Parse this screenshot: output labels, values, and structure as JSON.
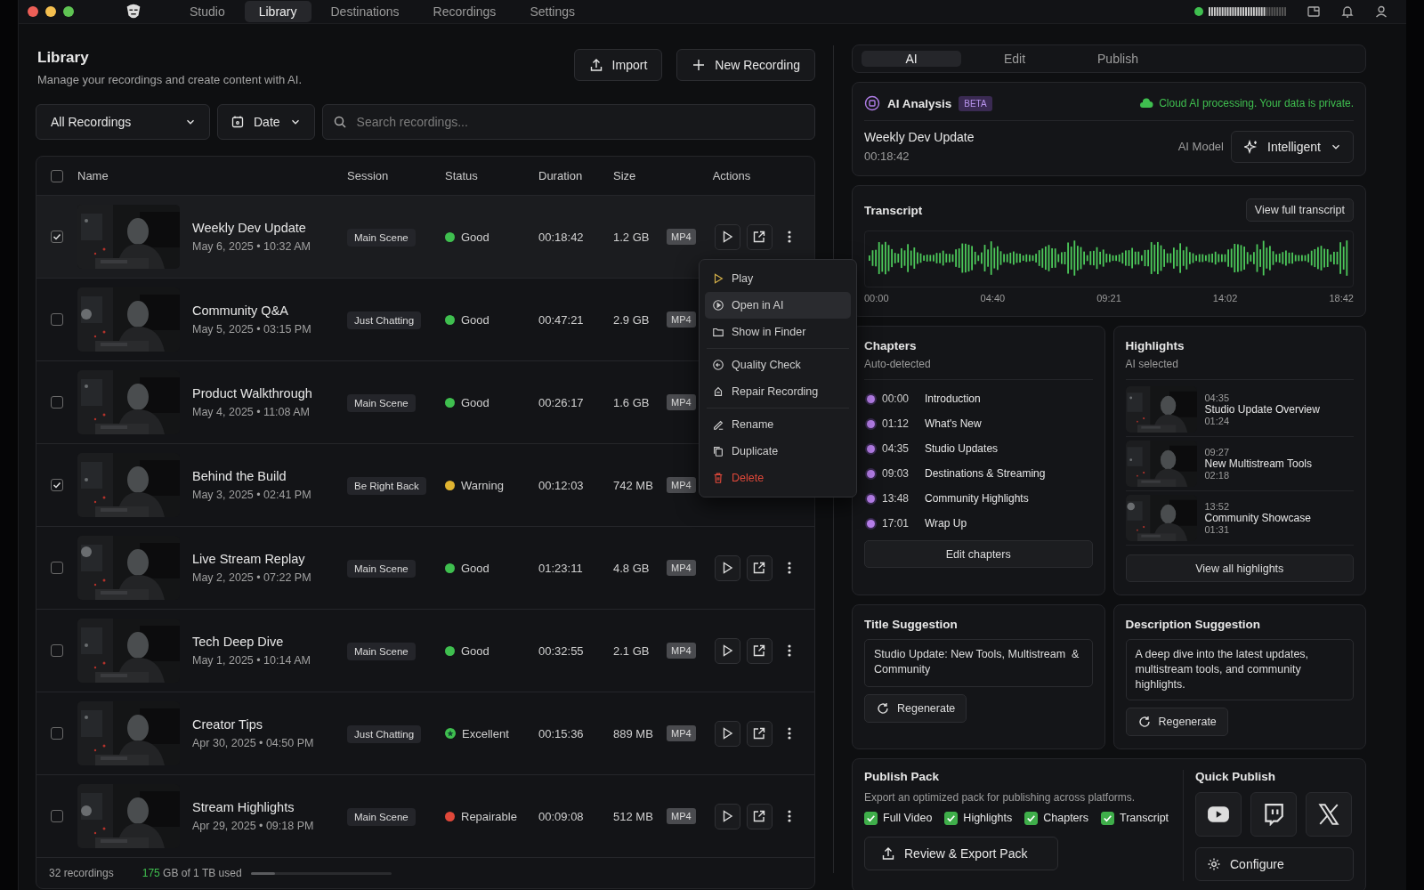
{
  "window": {
    "nav": [
      {
        "label": "Studio",
        "selected": false
      },
      {
        "label": "Library",
        "selected": true
      },
      {
        "label": "Destinations",
        "selected": false
      },
      {
        "label": "Recordings",
        "selected": false
      },
      {
        "label": "Settings",
        "selected": false
      }
    ]
  },
  "library": {
    "title": "Library",
    "subtitle": "Manage your recordings and create content with AI.",
    "import_button": "Import",
    "new_button": "New Recording",
    "filter": "All Recordings",
    "date_filter": "Date",
    "search": {
      "placeholder": "Search recordings..."
    }
  },
  "table": {
    "select_all": {
      "checked": false
    },
    "columns": [
      "Name",
      "Session",
      "Status",
      "Duration",
      "Size",
      "Actions"
    ],
    "rows": [
      {
        "name": "Weekly Dev Update",
        "date": "May 6, 2025 • 10:32 AM",
        "session": "Main Scene",
        "status": {
          "label": "Good",
          "kind": "dot",
          "color": "#3fbf4f"
        },
        "duration": "00:18:42",
        "size": "1.2 GB",
        "format": "MP4",
        "checked": true,
        "actions_visible": true
      },
      {
        "name": "Community Q&A",
        "date": "May 5, 2025 • 03:15 PM",
        "session": "Just Chatting",
        "status": {
          "label": "Good",
          "kind": "dot",
          "color": "#3fbf4f"
        },
        "duration": "00:47:21",
        "size": "2.9 GB",
        "format": "MP4",
        "checked": false,
        "actions_visible": false
      },
      {
        "name": "Product Walkthrough",
        "date": "May 4, 2025 • 11:08 AM",
        "session": "Main Scene",
        "status": {
          "label": "Good",
          "kind": "dot",
          "color": "#3fbf4f"
        },
        "duration": "00:26:17",
        "size": "1.6 GB",
        "format": "MP4",
        "checked": false,
        "actions_visible": false
      },
      {
        "name": "Behind the Build",
        "date": "May 3, 2025 • 02:41 PM",
        "session": "Be Right Back",
        "status": {
          "label": "Warning",
          "kind": "dot",
          "color": "#e0b431"
        },
        "duration": "00:12:03",
        "size": "742 MB",
        "format": "MP4",
        "checked": true,
        "actions_visible": false
      },
      {
        "name": "Live Stream Replay",
        "date": "May 2, 2025 • 07:22 PM",
        "session": "Main Scene",
        "status": {
          "label": "Good",
          "kind": "dot",
          "color": "#3fbf4f"
        },
        "duration": "01:23:11",
        "size": "4.8 GB",
        "format": "MP4",
        "checked": false,
        "actions_visible": true
      },
      {
        "name": "Tech Deep Dive",
        "date": "May 1, 2025 • 10:14 AM",
        "session": "Main Scene",
        "status": {
          "label": "Good",
          "kind": "dot",
          "color": "#3fbf4f"
        },
        "duration": "00:32:55",
        "size": "2.1 GB",
        "format": "MP4",
        "checked": false,
        "actions_visible": true
      },
      {
        "name": "Creator Tips",
        "date": "Apr 30, 2025 • 04:50 PM",
        "session": "Just Chatting",
        "status": {
          "label": "Excellent",
          "kind": "star",
          "color": "#3fbf4f"
        },
        "duration": "00:15:36",
        "size": "889 MB",
        "format": "MP4",
        "checked": false,
        "actions_visible": true
      },
      {
        "name": "Stream Highlights",
        "date": "Apr 29, 2025 • 09:18 PM",
        "session": "Main Scene",
        "status": {
          "label": "Repairable",
          "kind": "dot",
          "color": "#e0483a"
        },
        "duration": "00:09:08",
        "size": "512 MB",
        "format": "MP4",
        "checked": false,
        "actions_visible": true
      }
    ],
    "footer": {
      "count": "32 recordings",
      "used": "175",
      "used_rest": "GB of 1 TB used",
      "level": 0.175
    }
  },
  "context_menu": {
    "items": [
      {
        "kind": "play",
        "label": "Play",
        "selected": false,
        "danger": false,
        "divider_before": false
      },
      {
        "kind": "ai",
        "label": "Open in AI",
        "selected": true,
        "danger": false,
        "divider_before": false
      },
      {
        "kind": "folder",
        "label": "Show in Finder",
        "selected": false,
        "danger": false,
        "divider_before": false
      },
      {
        "kind": "check",
        "label": "Quality Check",
        "selected": false,
        "danger": false,
        "divider_before": true
      },
      {
        "kind": "repair",
        "label": "Repair Recording",
        "selected": false,
        "danger": false,
        "divider_before": false
      },
      {
        "kind": "rename",
        "label": "Rename",
        "selected": false,
        "danger": false,
        "divider_before": true
      },
      {
        "kind": "duplicate",
        "label": "Duplicate",
        "selected": false,
        "danger": false,
        "divider_before": false
      },
      {
        "kind": "delete",
        "label": "Delete",
        "selected": false,
        "danger": true,
        "divider_before": false
      }
    ]
  },
  "panel": {
    "tabs": [
      {
        "label": "AI",
        "selected": true
      },
      {
        "label": "Edit",
        "selected": false
      },
      {
        "label": "Publish",
        "selected": false
      }
    ],
    "analysis": {
      "title": "AI Analysis",
      "badge": "BETA",
      "privacy": "Cloud AI processing. Your data is private.",
      "recording": "Weekly Dev Update",
      "duration": "00:18:42",
      "model_label": "AI Model",
      "model": "Intelligent"
    },
    "transcript": {
      "title": "Transcript",
      "button": "View full transcript",
      "times": [
        "00:00",
        "04:40",
        "09:21",
        "14:02",
        "18:42"
      ]
    },
    "chapters": {
      "title": "Chapters",
      "subtitle": "Auto-detected",
      "items": [
        {
          "time": "00:00",
          "title": "Introduction"
        },
        {
          "time": "01:12",
          "title": "What's New"
        },
        {
          "time": "04:35",
          "title": "Studio Updates"
        },
        {
          "time": "09:03",
          "title": "Destinations & Streaming"
        },
        {
          "time": "13:48",
          "title": "Community Highlights"
        },
        {
          "time": "17:01",
          "title": "Wrap Up"
        }
      ],
      "button": "Edit chapters"
    },
    "highlights": {
      "title": "Highlights",
      "subtitle": "AI selected",
      "items": [
        {
          "time": "04:35",
          "title": "Studio Update Overview",
          "duration": "01:24"
        },
        {
          "time": "09:27",
          "title": "New Multistream Tools",
          "duration": "02:18"
        },
        {
          "time": "13:52",
          "title": "Community Showcase",
          "duration": "01:31"
        }
      ],
      "button": "View all highlights"
    },
    "title_suggestion": {
      "title": "Title Suggestion",
      "text": "Studio Update: New Tools, Multistream  & Community",
      "button": "Regenerate"
    },
    "description_suggestion": {
      "title": "Description Suggestion",
      "text": "A deep dive into the latest updates, multistream tools, and community highlights.",
      "button": "Regenerate"
    },
    "publish_pack": {
      "title": "Publish Pack",
      "text": "Export an optimized pack for publishing across platforms.",
      "options": [
        {
          "label": "Full Video",
          "checked": true
        },
        {
          "label": "Highlights",
          "checked": true
        },
        {
          "label": "Chapters",
          "checked": true
        },
        {
          "label": "Transcript",
          "checked": true
        }
      ],
      "button": "Review & Export Pack"
    },
    "quick_publish": {
      "title": "Quick Publish",
      "buttons": [
        {
          "kind": "video"
        },
        {
          "kind": "chat"
        },
        {
          "kind": "x"
        }
      ],
      "configure": "Configure"
    }
  }
}
